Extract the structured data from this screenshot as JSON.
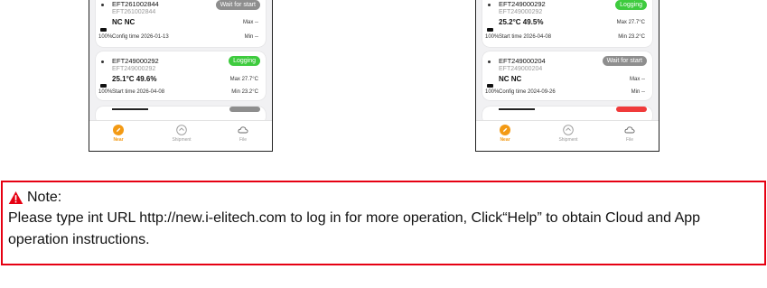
{
  "colors": {
    "accent": "#f39a14",
    "waiting": "#8e8e8e",
    "logging": "#3ecb3e",
    "alarm": "#f03b3b",
    "note_border": "#e60012"
  },
  "left_phone": {
    "devices": [
      {
        "name": "EFT261002844",
        "serial": "EFT261002844",
        "badge": "Wait for start",
        "values": "NC  NC",
        "max": "Max  --",
        "min": "Min  --",
        "battery": "100%",
        "time": "Config time  2026-01-13"
      },
      {
        "name": "EFT249000292",
        "serial": "EFT249000292",
        "badge": "Logging",
        "values": "25.1°C  49.6%",
        "max": "Max  27.7°C",
        "min": "Min  23.2°C",
        "battery": "100%",
        "time": "Start time  2026-04-08"
      }
    ]
  },
  "right_phone": {
    "devices": [
      {
        "name": "EFT249000292",
        "serial": "EFT249000292",
        "badge": "Logging",
        "values": "25.2°C  49.5%",
        "max": "Max  27.7°C",
        "min": "Min  23.2°C",
        "battery": "100%",
        "time": "Start time  2026-04-08"
      },
      {
        "name": "EFT249000204",
        "serial": "EFT249000204",
        "badge": "Wait for start",
        "values": "NC  NC",
        "max": "Max  --",
        "min": "Min  --",
        "battery": "100%",
        "time": "Config time  2024-09-26"
      }
    ]
  },
  "tabs": {
    "near": "Near",
    "shipment": "Shipment",
    "file": "File"
  },
  "note": {
    "title": "Note:",
    "body": "Please type int URL http://new.i-elitech.com to log in for more operation, Click“Help” to obtain Cloud and App operation instructions."
  }
}
